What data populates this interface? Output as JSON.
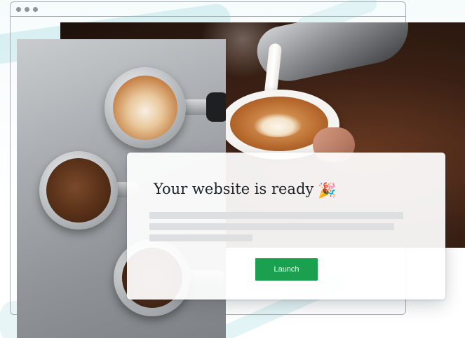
{
  "card": {
    "title": "Your website is ready",
    "emoji": "🎉",
    "launch_label": "Launch"
  },
  "colors": {
    "accent_green": "#1aa04e",
    "skeleton_gray": "#dedfe0",
    "window_border": "#a9aeb2",
    "brush_teal": "#cfecef"
  },
  "icons": {
    "window_dots": [
      "window-dot-icon",
      "window-dot-icon",
      "window-dot-icon"
    ],
    "celebration": "party-popper-icon"
  }
}
